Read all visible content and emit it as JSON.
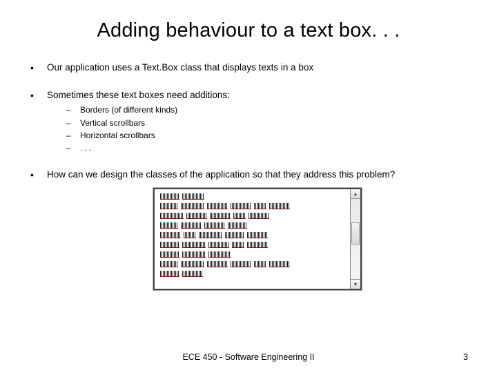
{
  "title": "Adding behaviour to a text box. . .",
  "bullets": {
    "b1": "Our application uses a Text.Box class that displays texts in a box",
    "b2": "Sometimes these text boxes need additions:",
    "b2_sub": {
      "s1": "Borders (of different kinds)",
      "s2": "Vertical scrollbars",
      "s3": "Horizontal scrollbars",
      "s4": ". . ."
    },
    "b3": "How can we design the classes of the application so that they address this problem?"
  },
  "footer": "ECE 450 - Software Engineering II",
  "page_number": "3"
}
